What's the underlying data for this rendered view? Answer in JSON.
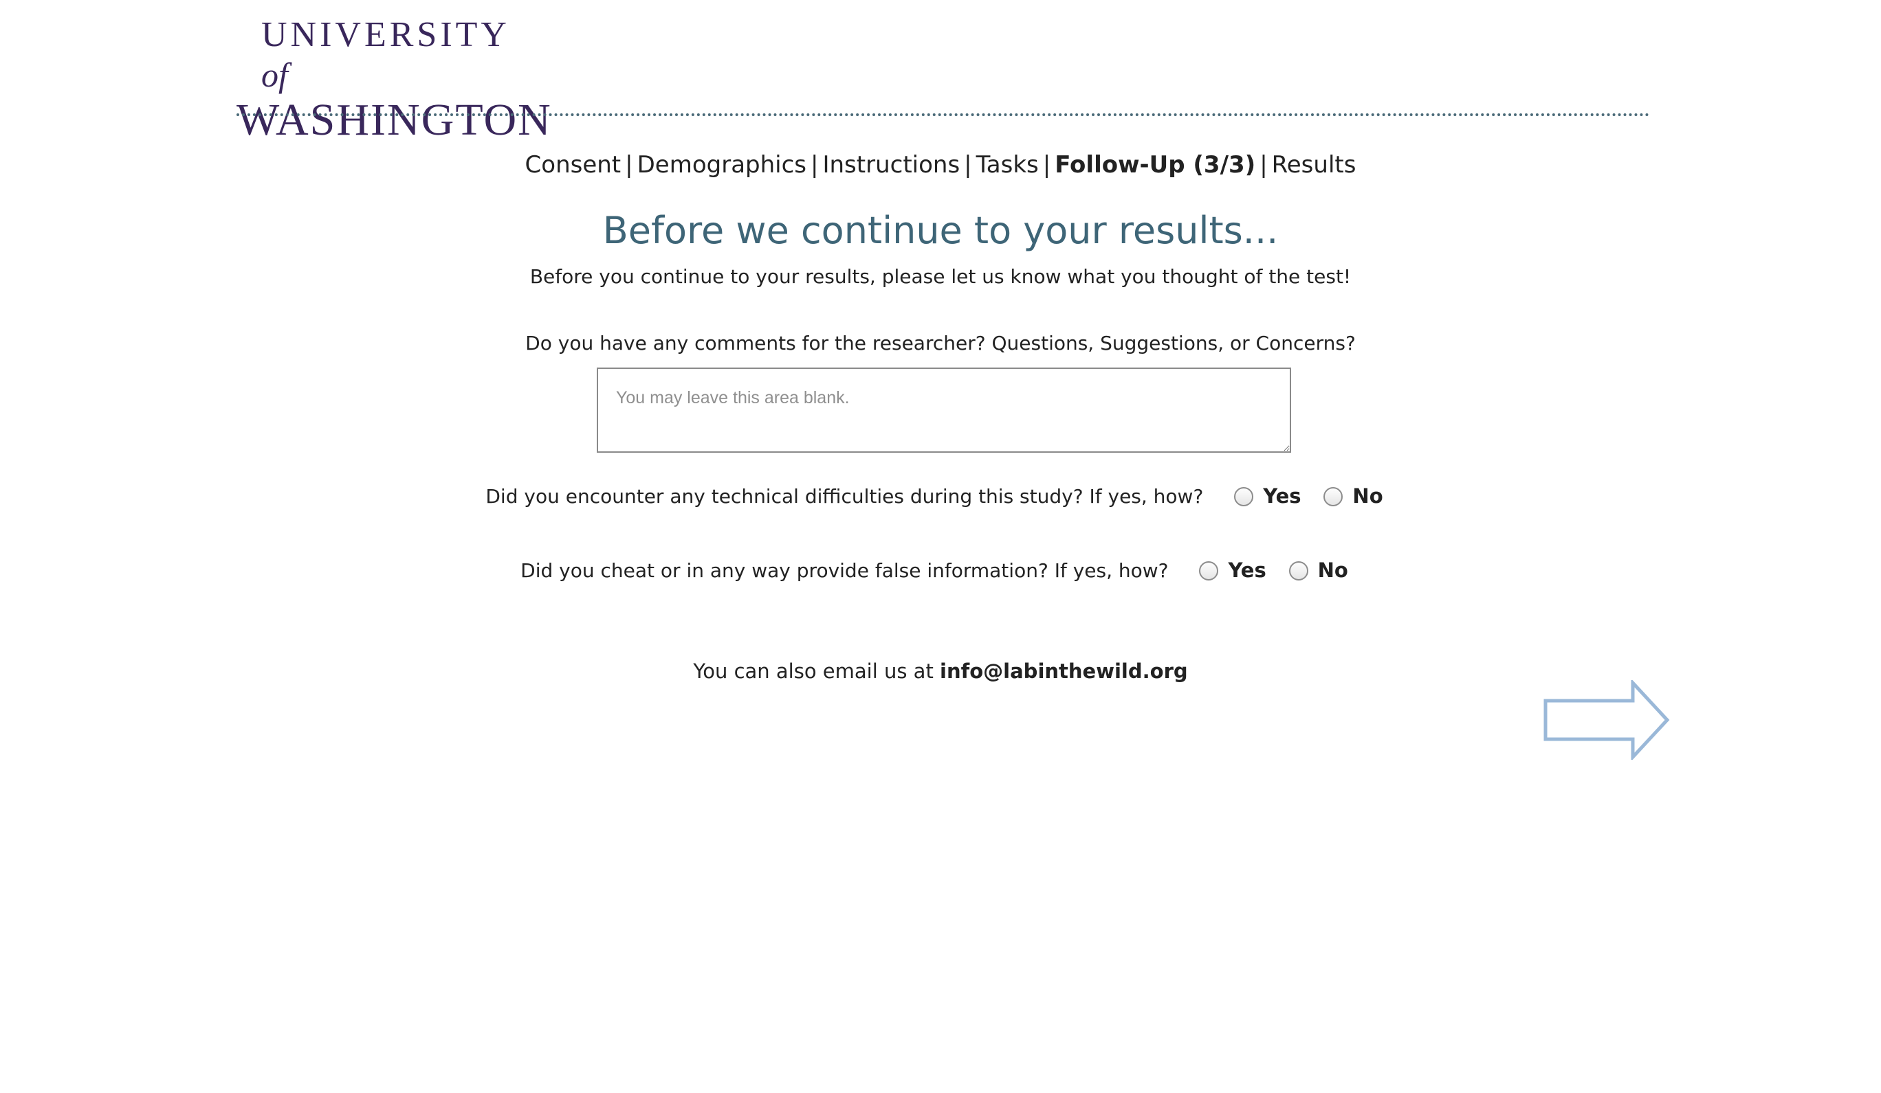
{
  "logo": {
    "line1_main": "UNIVERSITY",
    "line1_of": "of",
    "line2": "WASHINGTON",
    "color": "#39275b"
  },
  "nav": {
    "items": [
      "Consent",
      "Demographics",
      "Instructions",
      "Tasks",
      "Follow-Up (3/3)",
      "Results"
    ],
    "separator": "|",
    "current_index": 4
  },
  "heading": "Before we continue to your results...",
  "intro": "Before you continue to your results, please let us know what you thought of the test!",
  "comments": {
    "question": "Do you have any comments for the researcher? Questions, Suggestions, or Concerns?",
    "placeholder": "You may leave this area blank.",
    "value": ""
  },
  "technical": {
    "question": "Did you encounter any technical difficulties during this study? If yes, how?",
    "yes_label": "Yes",
    "no_label": "No",
    "selected": null
  },
  "cheat": {
    "question": "Did you cheat or in any way provide false information? If yes, how?",
    "yes_label": "Yes",
    "no_label": "No",
    "selected": null
  },
  "email": {
    "prefix": "You can also email us at",
    "address": "info@labinthewild.org"
  },
  "next_button": {
    "icon": "right-arrow-icon",
    "stroke_color": "#9ab8d8"
  },
  "colors": {
    "heading": "#3e6577",
    "divider": "#4a6a78",
    "text": "#222222"
  }
}
